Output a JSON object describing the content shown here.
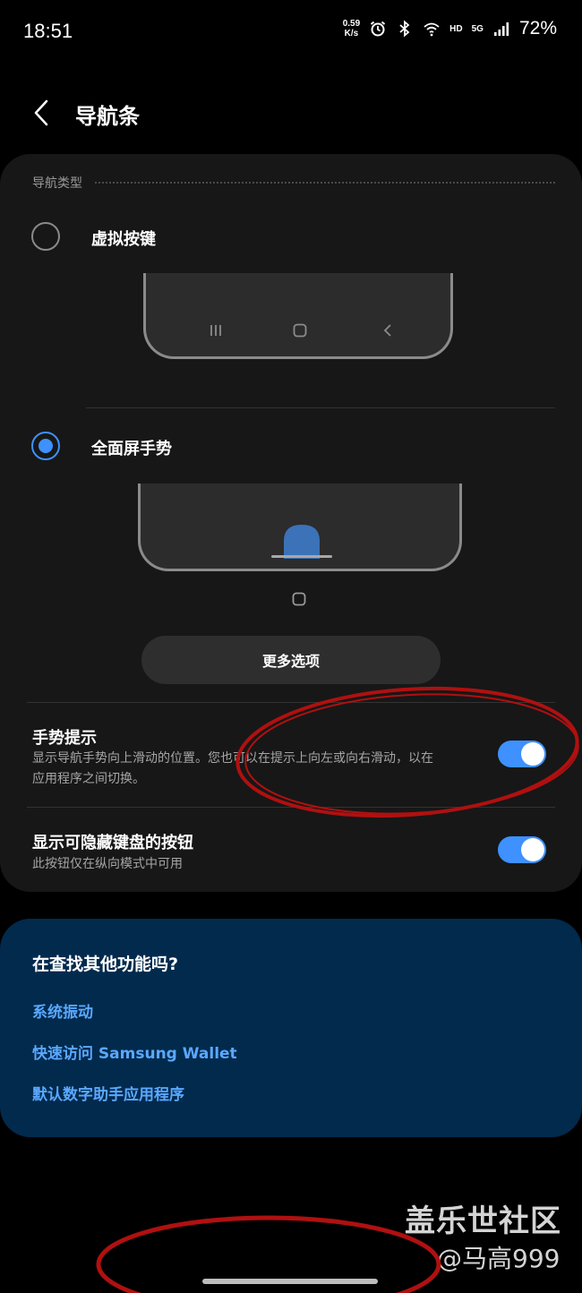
{
  "status_bar": {
    "time": "18:51",
    "net_speed_value": "0.59",
    "net_speed_unit": "K/s",
    "hd_label": "HD",
    "network_label": "5G",
    "battery": "72%"
  },
  "header": {
    "title": "导航条"
  },
  "nav_type": {
    "section_title": "导航类型",
    "options": [
      {
        "label": "虚拟按键",
        "selected": false
      },
      {
        "label": "全面屏手势",
        "selected": true
      }
    ],
    "more_options_label": "更多选项"
  },
  "settings": [
    {
      "title": "手势提示",
      "description_line1": "显示导航手势向上滑动的位置。您也可以在提示上向左或向右滑动，以在",
      "description_line2": "应用程序之间切换。",
      "enabled": true
    },
    {
      "title": "显示可隐藏键盘的按钮",
      "description": "此按钮仅在纵向模式中可用",
      "enabled": true
    }
  ],
  "suggestions": {
    "title": "在查找其他功能吗?",
    "links": [
      "系统振动",
      "快速访问 Samsung Wallet",
      "默认数字助手应用程序"
    ]
  },
  "watermark": {
    "line1": "盖乐世社区",
    "line2": "@马高999"
  },
  "colors": {
    "accent": "#3e91ff",
    "card_bg": "#171717",
    "suggest_bg": "#022a4d",
    "link": "#5aa8ff",
    "annotation": "#b01010"
  }
}
